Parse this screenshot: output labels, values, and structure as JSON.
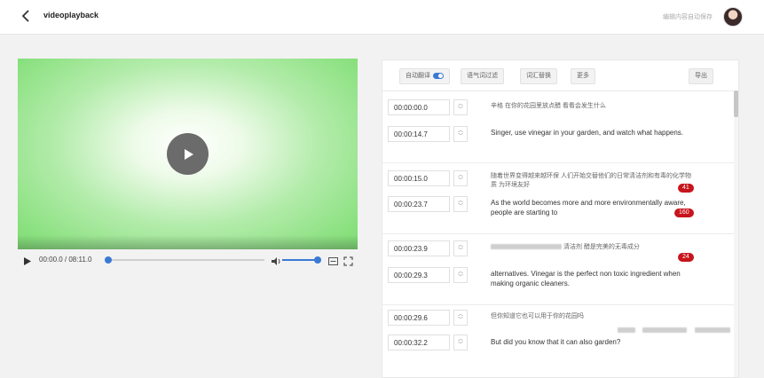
{
  "header": {
    "title": "videoplayback",
    "autosave_text": "编辑内容自动保存"
  },
  "player": {
    "timecode": "00:00.0 / 08:11.0",
    "progress_fraction": 0.0,
    "volume_fraction": 1.0
  },
  "toolbar": {
    "auto_translate": "自动翻译",
    "filter_fillers": "语气词过滤",
    "replace_words": "词汇替换",
    "more": "更多",
    "export": "导出"
  },
  "subtitles": [
    {
      "start": "00:00:00.0",
      "end": "00:00:14.7",
      "zh": "辛格 在你的花园里放点醋 看看会发生什么",
      "en": "Singer, use vinegar in your garden, and watch what happens.",
      "badges": []
    },
    {
      "start": "00:00:15.0",
      "end": "00:00:23.7",
      "zh": "随着世界变得越来越环保 人们开始交替他们的日常清洁剂和有毒的化学物质 为环境友好",
      "en": "As the world becomes more and more environmentally aware, people are starting to",
      "badges": [
        "41",
        "160"
      ]
    },
    {
      "start": "00:00:23.9",
      "end": "00:00:29.3",
      "zh": "清洁剂 醋是完美的无毒成分",
      "en": "alternatives. Vinegar is the perfect non toxic ingredient when making organic cleaners.",
      "badges": [
        "24"
      ]
    },
    {
      "start": "00:00:29.6",
      "end": "00:00:32.2",
      "zh": "但你知道它也可以用于你的花园吗",
      "en": "But did you know that it can also garden?",
      "badges": []
    }
  ]
}
